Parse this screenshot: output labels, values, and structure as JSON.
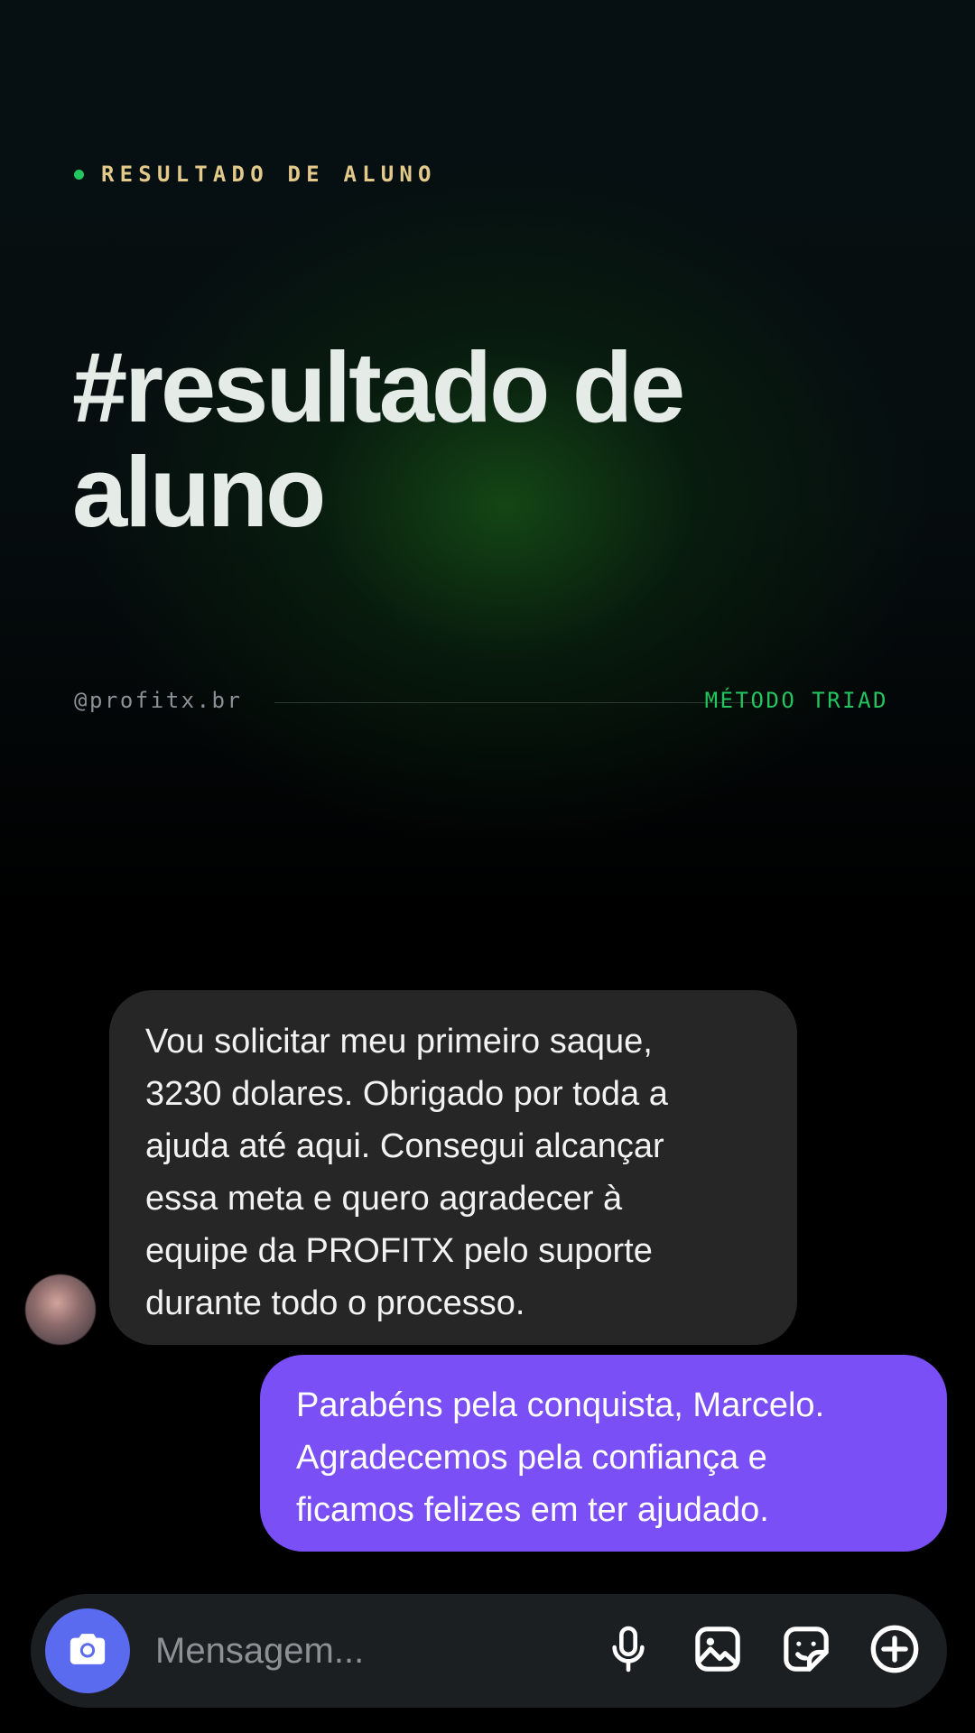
{
  "header": {
    "eyebrow": "RESULTADO DE ALUNO",
    "headline_line1": "#resultado de",
    "headline_line2": "aluno",
    "handle": "@profitx.br",
    "method": "MÉTODO TRIAD"
  },
  "chat": {
    "received_message": "Vou solicitar meu primeiro saque, 3230 dolares. Obrigado por toda a ajuda até aqui. Consegui alcançar essa meta e quero agradecer à equipe da PROFITX pelo suporte durante todo o processo.",
    "received_lines": [
      "Vou solicitar meu primeiro saque,",
      "3230 dolares. Obrigado por toda a",
      "ajuda até aqui. Consegui alcançar",
      "essa meta e quero agradecer à",
      "equipe da PROFITX pelo suporte",
      "durante todo o processo."
    ],
    "sent_message": "Parabéns pela conquista, Marcelo. Agradecemos pela confiança e ficamos felizes em ter ajudado.",
    "sent_lines": [
      "Parabéns pela conquista, Marcelo.",
      "Agradecemos pela confiança e",
      "ficamos felizes em ter ajudado."
    ]
  },
  "composer": {
    "placeholder": "Mensagem...",
    "value": "",
    "icons": [
      "camera-icon",
      "microphone-icon",
      "gallery-icon",
      "sticker-icon",
      "plus-icon"
    ]
  },
  "colors": {
    "accent_green": "#22c55e",
    "eyebrow_gold": "#e3c98a",
    "sent_bubble": "#7a4ff5",
    "received_bubble": "#262626",
    "camera_button": "#5b6bf0"
  }
}
